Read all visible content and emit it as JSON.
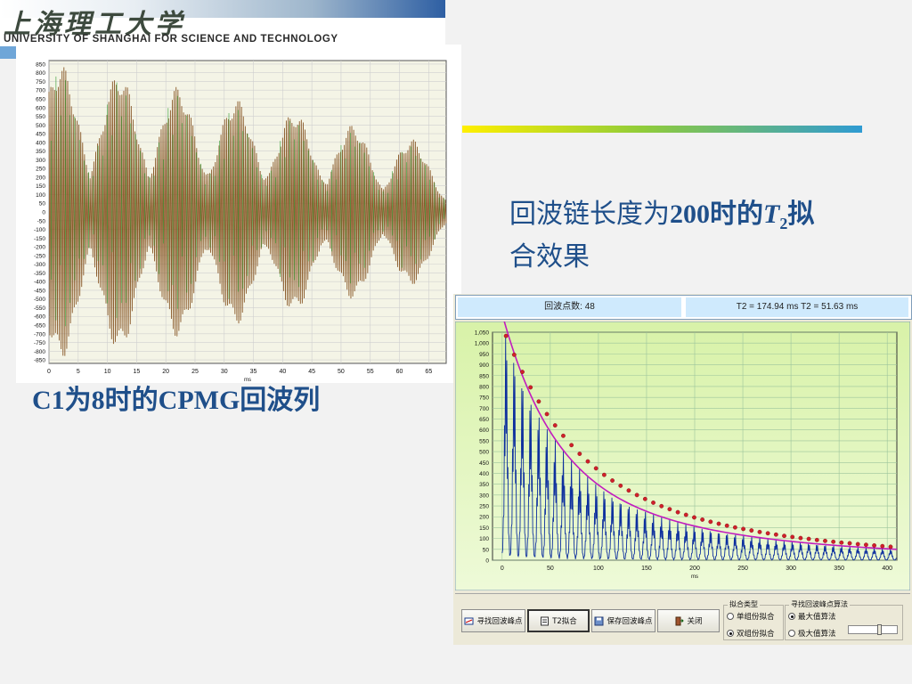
{
  "header": {
    "logo_calligraphy": "上海理工大学",
    "university_name_en": "UNIVERSITY OF SHANGHAI FOR SCIENCE AND TECHNOLOGY"
  },
  "captions": {
    "left": "C1为8时的CPMG回波列",
    "right_prefix": "回波链长度为",
    "right_number": "200",
    "right_mid": "时的",
    "right_T": "T",
    "right_sub": "2",
    "right_suffix": "拟",
    "right_line2": "合效果"
  },
  "fit_window": {
    "echo_count_label": "回波点数: 48",
    "t2_label": "T2 = 174.94 ms  T2 =   51.63 ms",
    "buttons": {
      "find_peaks": "寻找回波峰点",
      "t2_fit": "T2拟合",
      "save_peaks": "保存回波峰点",
      "close": "关闭"
    },
    "fit_type_group": {
      "title": "拟合类型",
      "single": "单组份拟合",
      "double": "双组份拟合",
      "selected": "double"
    },
    "algorithm_group": {
      "title": "寻找回波峰点算法",
      "max": "最大值算法",
      "extreme": "极大值算法",
      "selected": "max"
    },
    "slider_value": 0.65
  },
  "colors": {
    "plot1_bg": "#f4f4e6",
    "plot1_grid": "#cfcfcf",
    "signal_brown": "#8a5a2a",
    "signal_green": "#2e9a2e",
    "plot2_bg_top": "#d8f2a8",
    "plot2_bg_bottom": "#eefad8",
    "plot2_grid": "#9cc49c",
    "echo_blue": "#0d2f9e",
    "fit_magenta": "#c21cbe",
    "peak_red": "#d0202a",
    "caption_blue": "#1f4f8a"
  },
  "chart_data": [
    {
      "type": "line",
      "title": "",
      "xlabel": "ms",
      "ylabel": "",
      "xlim": [
        0,
        68
      ],
      "ylim": [
        -870,
        870
      ],
      "x_ticks": [
        0,
        5,
        10,
        15,
        20,
        25,
        30,
        35,
        40,
        45,
        50,
        55,
        60,
        65
      ],
      "y_ticks": [
        850,
        800,
        750,
        700,
        650,
        600,
        550,
        500,
        450,
        400,
        350,
        300,
        250,
        200,
        150,
        100,
        50,
        0,
        -50,
        -100,
        -150,
        -200,
        -250,
        -300,
        -350,
        -400,
        -450,
        -500,
        -550,
        -600,
        -650,
        -700,
        -750,
        -800,
        -850
      ],
      "grid": true,
      "series": [
        {
          "kind": "cpmg_echo_train",
          "color": "#8a5a2a",
          "echo_peak_times_ms": [
            2,
            12,
            22,
            32,
            42,
            52,
            62
          ],
          "echo_peak_amplitudes": [
            850,
            800,
            720,
            650,
            580,
            500,
            420
          ],
          "fill_amplitude_envelope": [
            [
              0,
              220
            ],
            [
              44,
              220
            ],
            [
              53,
              140
            ],
            [
              66,
              70
            ],
            [
              68,
              60
            ]
          ],
          "signal_end_ms": 68
        },
        {
          "kind": "overlay_spikes",
          "color": "#2e9a2e"
        }
      ]
    },
    {
      "type": "line",
      "title": "",
      "xlabel": "ms",
      "ylabel": "",
      "xlim": [
        -10,
        410
      ],
      "ylim": [
        0,
        1050
      ],
      "x_ticks": [
        0,
        50,
        100,
        150,
        200,
        250,
        300,
        350,
        400
      ],
      "y_ticks": [
        1050,
        1000,
        950,
        900,
        850,
        800,
        750,
        700,
        650,
        600,
        550,
        500,
        450,
        400,
        350,
        300,
        250,
        200,
        150,
        100,
        50,
        0
      ],
      "y_tick_labels": [
        "1,050",
        "1,000",
        "950",
        "900",
        "850",
        "800",
        "750",
        "700",
        "650",
        "600",
        "550",
        "500",
        "450",
        "400",
        "350",
        "300",
        "250",
        "200",
        "150",
        "100",
        "50",
        "0"
      ],
      "grid": true,
      "series": [
        {
          "kind": "echo_train",
          "color": "#0d2f9e",
          "echo_period_ms": 8.5,
          "first_echo_ms": 4,
          "end_ms": 410
        },
        {
          "kind": "biexponential_fit",
          "color": "#c21cbe",
          "t2_long_ms": 174.94,
          "t2_short_ms": 51.63,
          "amp_long": 415,
          "amp_short": 710,
          "offset": 10
        },
        {
          "kind": "fitted_peaks",
          "color": "#d0202a",
          "x": [
            4.0,
            12.5,
            21.0,
            29.5,
            38.0,
            46.5,
            55.0,
            63.5,
            72.0,
            80.5,
            89.0,
            97.5,
            106.0,
            114.5,
            123.0,
            131.5,
            140.0,
            148.5,
            157.0,
            165.5,
            174.0,
            182.5,
            191.0,
            199.5,
            208.0,
            216.5,
            225.0,
            233.5,
            242.0,
            250.5,
            259.0,
            267.5,
            276.0,
            284.5,
            293.0,
            301.5,
            310.0,
            318.5,
            327.0,
            335.5,
            344.0,
            352.5,
            361.0,
            369.5,
            378.0,
            386.5,
            395.0,
            403.5
          ],
          "y": [
            1033,
            946,
            867,
            796,
            731,
            673,
            621,
            573,
            530,
            490,
            455,
            423,
            393,
            367,
            343,
            321,
            300,
            282,
            265,
            249,
            235,
            221,
            209,
            197,
            187,
            177,
            168,
            159,
            151,
            144,
            137,
            130,
            124,
            118,
            112,
            107,
            102,
            98,
            93,
            89,
            85,
            81,
            78,
            74,
            71,
            68,
            65,
            62
          ]
        }
      ]
    }
  ]
}
